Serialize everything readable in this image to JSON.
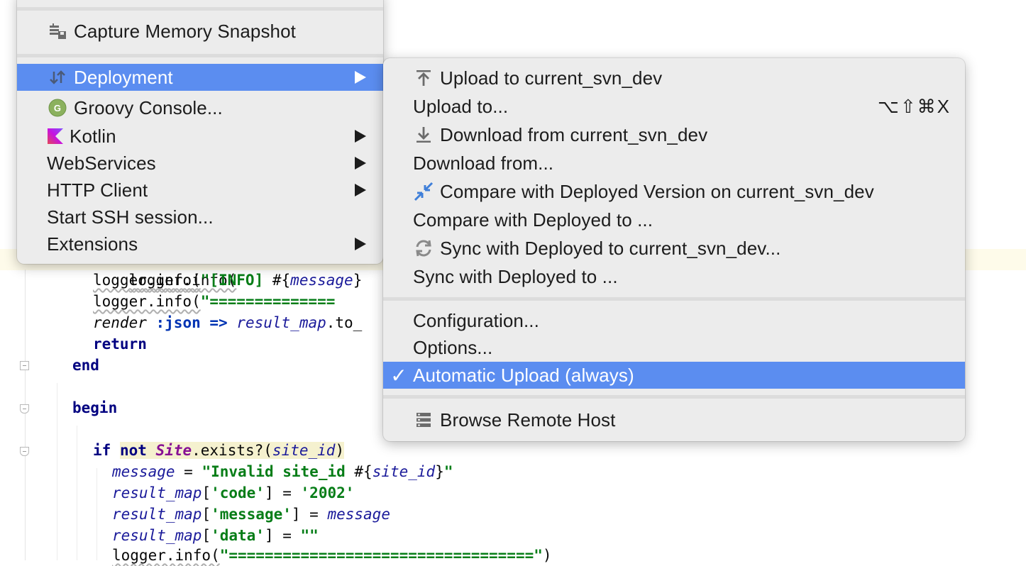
{
  "code": {
    "line_logger_partial": "logger.info(",
    "line2": {
      "fn": "logger.info(",
      "str": "\"[INFO] ",
      "interp_open": "#{",
      "var": "message",
      "interp_close": "}"
    },
    "line3": {
      "fn": "logger.info(",
      "str": "\"=============="
    },
    "line4": {
      "kw": "render",
      "sym": ":json",
      "op": " => ",
      "var": "result_map",
      "rest": ".to_"
    },
    "line5": {
      "kw": "return"
    },
    "line6": {
      "kw": "end"
    },
    "line7": {
      "kw": "begin"
    },
    "line8": {
      "if": "if",
      "not": "not",
      "cls": "Site",
      "call": ".exists?(",
      "var": "site_id",
      "close": ")"
    },
    "line9": {
      "var": "message",
      "eq": " = ",
      "str": "\"Invalid site_id ",
      "interp_open": "#{",
      "ivar": "site_id",
      "interp_close": "}",
      "str_end": "\""
    },
    "line10": {
      "var": "result_map",
      "open": "[",
      "key": "'code'",
      "close": "] = ",
      "val": "'2002'"
    },
    "line11": {
      "var": "result_map",
      "open": "[",
      "key": "'message'",
      "close": "] = ",
      "val": "message"
    },
    "line12": {
      "var": "result_map",
      "open": "[",
      "key": "'data'",
      "close": "] = ",
      "val": "\"\""
    },
    "line13": {
      "fn": "logger.info(",
      "str": "\"==================================\"",
      "close": ")"
    }
  },
  "main_menu": {
    "items": [
      {
        "label": "Capture Memory Snapshot",
        "icon": "memory-snapshot-icon"
      },
      {
        "label": "Deployment",
        "icon": "deployment-arrows-icon",
        "submenu": true,
        "selected": true
      },
      {
        "label": "Groovy Console...",
        "icon": "groovy-icon"
      },
      {
        "label": "Kotlin",
        "icon": "kotlin-icon",
        "submenu": true
      },
      {
        "label": "WebServices",
        "submenu": true
      },
      {
        "label": "HTTP Client",
        "submenu": true
      },
      {
        "label": "Start SSH session..."
      },
      {
        "label": "Extensions",
        "submenu": true
      }
    ]
  },
  "deployment_menu": {
    "items": [
      {
        "label": "Upload to current_svn_dev",
        "icon": "upload-icon"
      },
      {
        "label": "Upload to...",
        "shortcut": "⌥⇧⌘X"
      },
      {
        "label": "Download from current_svn_dev",
        "icon": "download-icon"
      },
      {
        "label": "Download from..."
      },
      {
        "label": "Compare with Deployed Version on current_svn_dev",
        "icon": "compare-icon"
      },
      {
        "label": "Compare with Deployed to ..."
      },
      {
        "label": "Sync with Deployed to current_svn_dev...",
        "icon": "sync-icon"
      },
      {
        "label": "Sync with Deployed to ..."
      },
      {
        "label": "Configuration..."
      },
      {
        "label": "Options..."
      },
      {
        "label": "Automatic Upload (always)",
        "checked": true,
        "check_mark": "✓",
        "selected": true
      },
      {
        "label": "Browse Remote Host",
        "icon": "remote-host-icon"
      }
    ]
  },
  "colors": {
    "selection": "#5b8df0",
    "menu_bg": "#ececec",
    "keyword": "#0033b3",
    "string": "#067d17"
  }
}
